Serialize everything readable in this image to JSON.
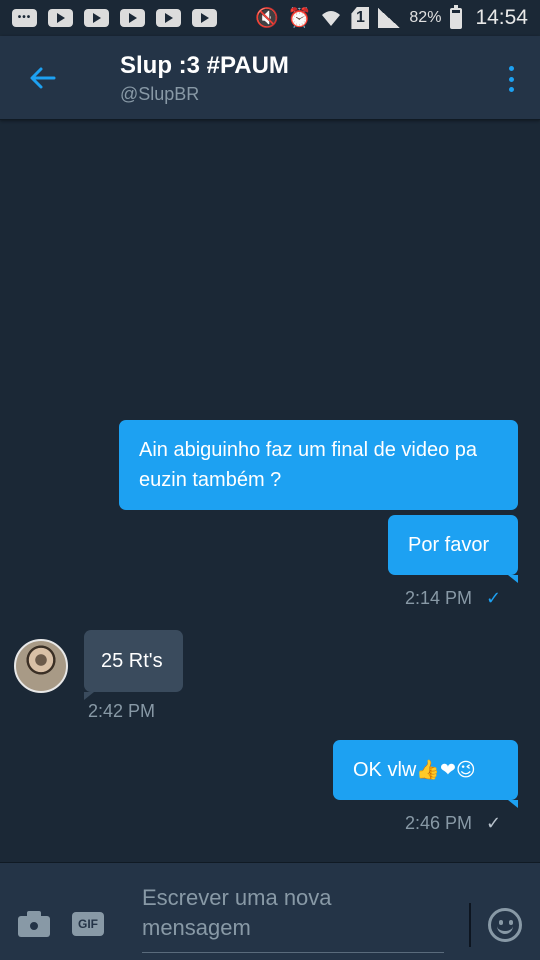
{
  "status_bar": {
    "battery": "82%",
    "time": "14:54",
    "sim_slot": "1"
  },
  "header": {
    "title": "Slup :3 #PAUM",
    "handle": "@SlupBR"
  },
  "messages": [
    {
      "direction": "outgoing",
      "text": "Ain abiguinho faz um final de video pa euzin também ?"
    },
    {
      "direction": "outgoing",
      "text": "Por favor",
      "time": "2:14 PM",
      "status": "read"
    },
    {
      "direction": "incoming",
      "text": "25 Rt's",
      "time": "2:42 PM"
    },
    {
      "direction": "outgoing",
      "text": "OK vlw",
      "emojis": "👍❤😉",
      "time": "2:46 PM",
      "status": "sent"
    }
  ],
  "composer": {
    "placeholder": "Escrever uma nova mensagem",
    "gif_label": "GIF"
  },
  "colors": {
    "background": "#1b2836",
    "header": "#243447",
    "accent": "#1da1f2",
    "incoming_bubble": "#3a4b5d",
    "secondary_text": "#8899a6"
  },
  "icons": [
    "back-arrow-icon",
    "more-vertical-icon",
    "camera-icon",
    "gif-icon",
    "emoji-icon",
    "check-icon"
  ]
}
